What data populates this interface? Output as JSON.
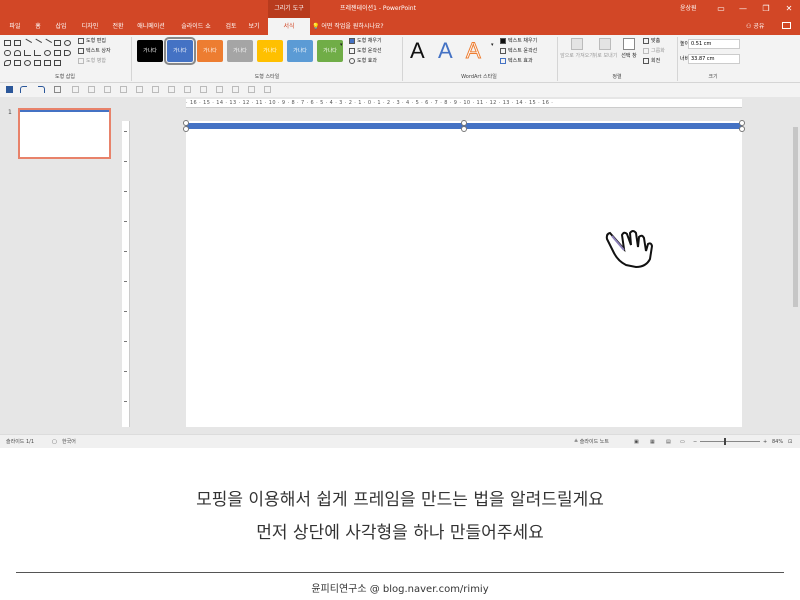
{
  "titlebar": {
    "context_tab": "그리기 도구",
    "doc_title": "프레젠테이션1 - PowerPoint",
    "user": "윤상원",
    "minimize": "—",
    "restore": "❐",
    "close": "✕"
  },
  "menu": {
    "items": [
      "파일",
      "홈",
      "삽입",
      "디자인",
      "전환",
      "애니메이션",
      "슬라이드 쇼",
      "검토",
      "보기",
      "서식"
    ],
    "active": "서식",
    "tell_me": "어떤 작업을 원하시나요?",
    "share": "공유"
  },
  "ribbon": {
    "shape_insert": {
      "label": "도형 삽입",
      "edit_shape": "도형 편집",
      "text_box": "텍스트 상자",
      "merge_shapes": "도형 병합"
    },
    "shape_styles": {
      "label": "도형 스타일",
      "sample_text": "가나다",
      "fill": "도형 채우기",
      "outline": "도형 윤곽선",
      "effects": "도형 효과",
      "colors": [
        "#000000",
        "#4472c4",
        "#ed7d31",
        "#a5a5a5",
        "#ffc000",
        "#5b9bd5",
        "#70ad47"
      ]
    },
    "wordart": {
      "label": "WordArt 스타일",
      "letter": "A",
      "text_fill": "텍스트 채우기",
      "text_outline": "텍스트 윤곽선",
      "text_effects": "텍스트 효과"
    },
    "arrange": {
      "label": "정렬",
      "bring_forward": "앞으로 가져오기",
      "send_backward": "뒤로 보내기",
      "selection_pane": "선택 창",
      "align": "맞춤",
      "group": "그룹화",
      "rotate": "회전"
    },
    "size": {
      "label": "크기",
      "height_label": "높이:",
      "height_value": "0.51 cm",
      "width_label": "너비:",
      "width_value": "33.87 cm"
    }
  },
  "slides": {
    "number": "1"
  },
  "ruler": {
    "h_text": "· 16 · 15 · 14 · 13 · 12 · 11 · 10 · 9 · 8 · 7 · 6 · 5 · 4 · 3 · 2 · 1 · 0 · 1 · 2 · 3 · 4 · 5 · 6 · 7 · 8 · 9 · 10 · 11 · 12 · 13 · 14 · 15 · 16 ·"
  },
  "slide": {
    "shape_color": "#4472c4"
  },
  "status": {
    "slide_info": "슬라이드 1/1",
    "language": "한국어",
    "notes": "슬라이드 노트",
    "zoom": "84%",
    "zoom_level": 0.84,
    "zoom_minus": "−",
    "zoom_plus": "+"
  },
  "caption": {
    "line1": "모핑을 이용해서 쉽게 프레임을 만드는 법을 알려드릴게요",
    "line2": "먼저 상단에 사각형을 하나 만들어주세요",
    "credit": "윤피티연구소 @ blog.naver.com/rimiy"
  }
}
